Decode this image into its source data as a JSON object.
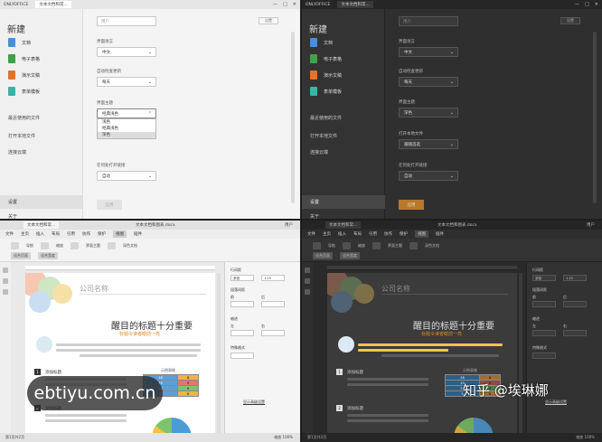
{
  "app": {
    "logo": "ONLYOFFICE",
    "tab_title": "文本文档和常...",
    "window_controls": [
      "—",
      "□",
      "✕"
    ]
  },
  "start_screen": {
    "heading": "新建",
    "items": [
      {
        "label": "文档",
        "color": "#4a8fd6"
      },
      {
        "label": "电子表格",
        "color": "#3fa14a"
      },
      {
        "label": "演示文稿",
        "color": "#e0732c"
      },
      {
        "label": "表单模板",
        "color": "#39b3a8"
      }
    ],
    "links": [
      "最近使用的文件",
      "打开本地文件",
      "连接云端"
    ],
    "settings": "设置",
    "about": "关于"
  },
  "settings_light": {
    "name_placeholder": "用户",
    "corner_button": "设置",
    "fields": [
      {
        "label": "界面语言",
        "value": "中文"
      },
      {
        "label": "自动检查更新",
        "value": "每天"
      },
      {
        "label": "界面主题",
        "value": "经典浅色"
      },
      {
        "label": "在何处打开链接",
        "value": "自动"
      }
    ],
    "theme_options": [
      "浅色",
      "经典浅色",
      "深色"
    ],
    "highlighted_option_index": 2,
    "apply_button": "应用"
  },
  "settings_dark": {
    "name_placeholder": "用户",
    "corner_button": "设置",
    "fields": [
      {
        "label": "界面语言",
        "value": "中文"
      },
      {
        "label": "自动检查更新",
        "value": "每天"
      },
      {
        "label": "界面主题",
        "value": "深色"
      },
      {
        "label": "打开本地文件",
        "value": "跟随首选"
      },
      {
        "label": "在何处打开链接",
        "value": "自动"
      }
    ],
    "apply_button": "应用"
  },
  "editor": {
    "tab_title": "文本文档和常...",
    "doc_title": "文本文档和图表.docx",
    "user": "用户",
    "menu": [
      "文件",
      "主页",
      "插入",
      "布局",
      "引用",
      "协作",
      "保护",
      "视图",
      "插件"
    ],
    "active_menu_index": 7,
    "toolbar_items": [
      "导航",
      "缩放",
      "适合页面",
      "适合宽度",
      "界面主题",
      "深色文档"
    ],
    "company": "公司名称",
    "headline": "醒目的标题十分重要",
    "subhead": "标题令读者眼前一亮",
    "table_caption": "示例表格",
    "table_rows": [
      [
        "48",
        "8"
      ],
      [
        "49",
        "9"
      ],
      [
        "50",
        "9"
      ],
      [
        "5",
        "8"
      ]
    ],
    "section_titles": [
      "添加标题",
      "添加标题"
    ],
    "right_panel": [
      "行间距",
      "多倍",
      "段落间距",
      "前",
      "后",
      "缩进",
      "左",
      "右",
      "特殊格式",
      "显示高级设置"
    ],
    "panel_value": "1.15",
    "statusbar_left": "第1页共2页",
    "statusbar_right": "缩放 100%"
  },
  "watermarks": {
    "left": "ebtiyu.com.cn",
    "right": "知乎 @埃琳娜"
  },
  "colors": {
    "accent_orange": "#e08a1e",
    "highlight_yellow": "#f4c24a"
  }
}
